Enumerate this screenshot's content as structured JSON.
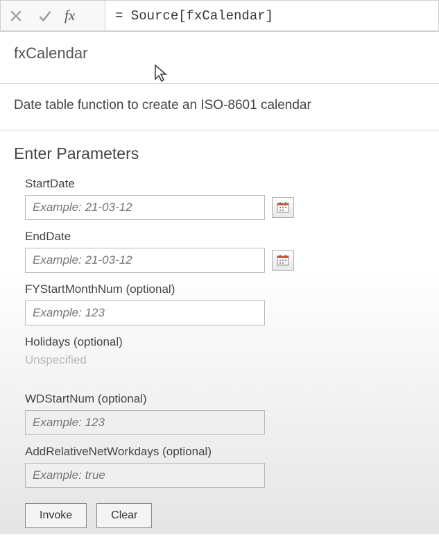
{
  "formula_bar": {
    "fx_label": "fx",
    "value": "= Source[fxCalendar]"
  },
  "function": {
    "name": "fxCalendar",
    "description": "Date table function to create an ISO-8601 calendar"
  },
  "section_title": "Enter Parameters",
  "params": {
    "start_date": {
      "label": "StartDate",
      "placeholder": "Example: 21-03-12"
    },
    "end_date": {
      "label": "EndDate",
      "placeholder": "Example: 21-03-12"
    },
    "fy_start": {
      "label": "FYStartMonthNum (optional)",
      "placeholder": "Example: 123"
    },
    "holidays": {
      "label": "Holidays (optional)",
      "unspecified": "Unspecified"
    },
    "wd_start": {
      "label": "WDStartNum (optional)",
      "placeholder": "Example: 123"
    },
    "rel_net": {
      "label": "AddRelativeNetWorkdays (optional)",
      "placeholder": "Example: true"
    }
  },
  "buttons": {
    "invoke": "Invoke",
    "clear": "Clear"
  }
}
